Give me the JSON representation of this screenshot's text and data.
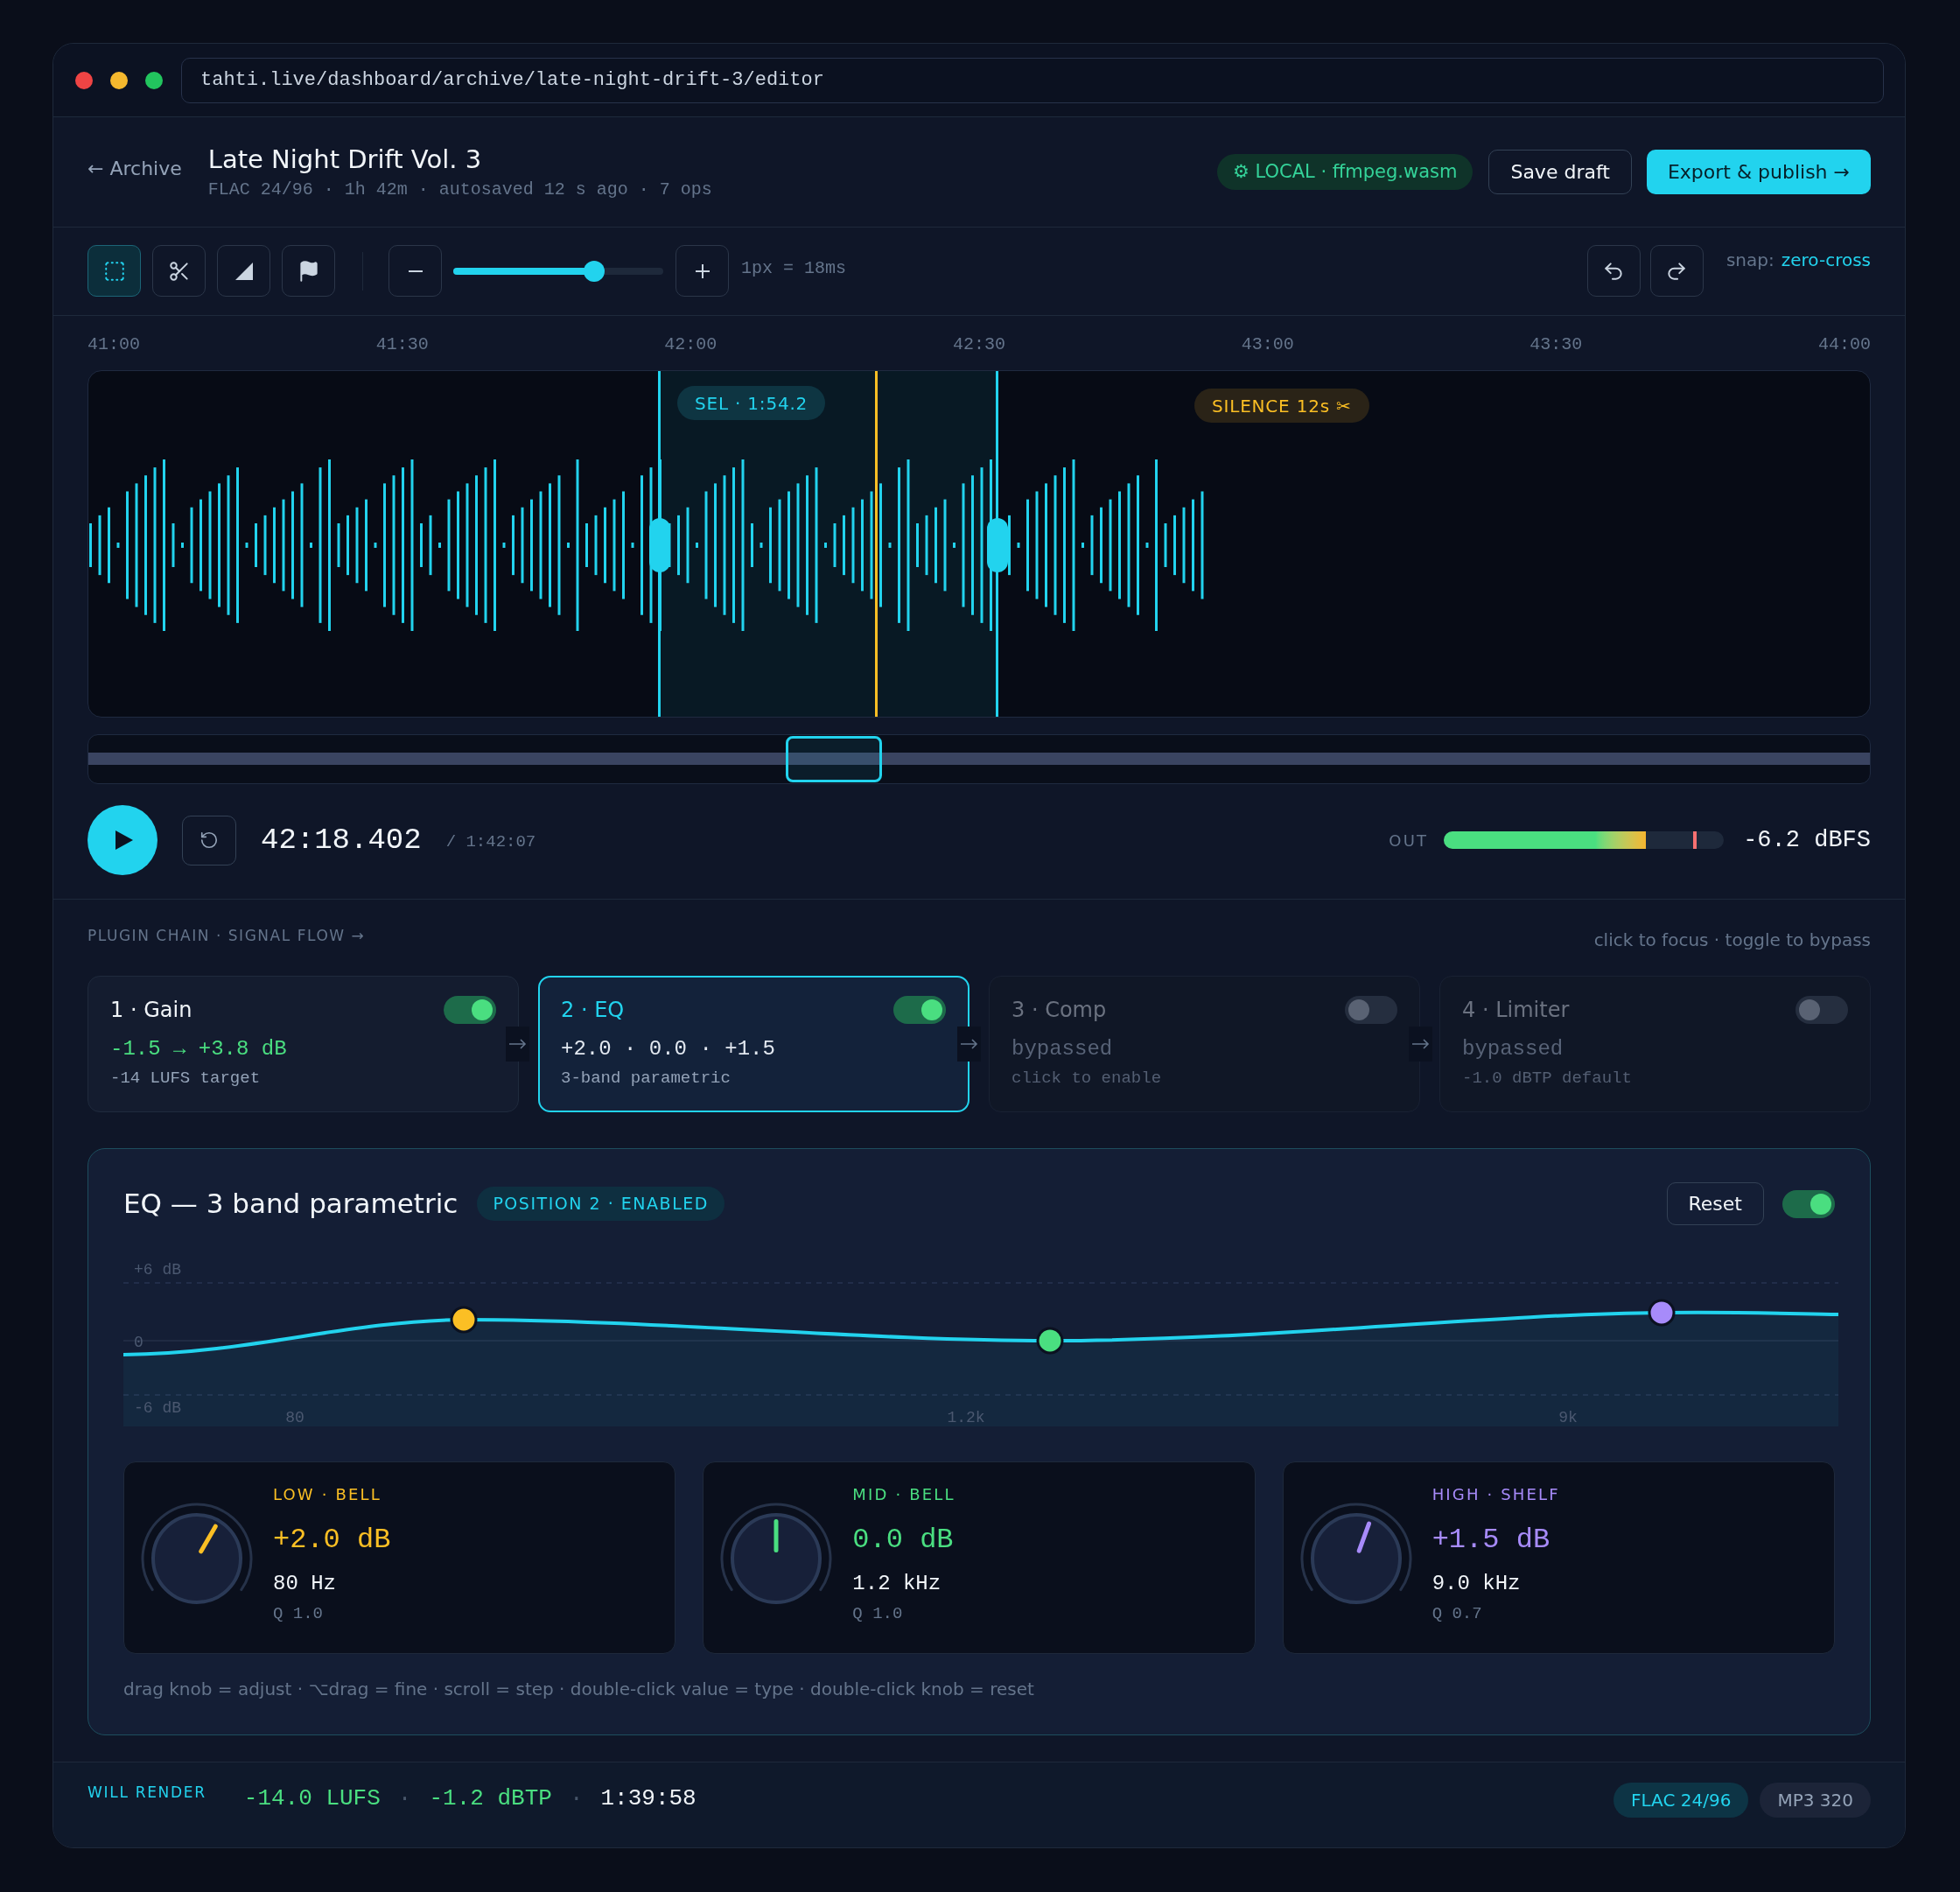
{
  "browser": {
    "url": "tahti.live/dashboard/archive/late-night-drift-3/editor"
  },
  "header": {
    "back_link": "← Archive",
    "title": "Late Night Drift Vol. 3",
    "subtitle": "FLAC 24/96 · 1h 42m · autosaved 12 s ago · 7 ops",
    "engine_badge": "⚙ LOCAL · ffmpeg.wasm",
    "buttons": [
      {
        "label": "Save draft",
        "kind": "secondary"
      },
      {
        "label": "Export & publish →",
        "kind": "primary"
      }
    ]
  },
  "toolbar": {
    "tools": [
      {
        "kind": "select",
        "selected": true
      },
      {
        "kind": "cut",
        "selected": false
      },
      {
        "kind": "fade",
        "selected": false
      },
      {
        "kind": "marker",
        "selected": false
      }
    ],
    "zoom": {
      "level": 0.67
    },
    "scale": "1px = 18ms",
    "snap_label": "snap:",
    "snap_value": "zero-cross"
  },
  "timeline": {
    "ruler": [
      "41:00",
      "41:30",
      "42:00",
      "42:30",
      "43:00",
      "43:30",
      "44:00"
    ],
    "selection_label": "SEL · 1:54.2",
    "silence_label": "SILENCE 12s ✂"
  },
  "transport": {
    "playing": false,
    "time": "42:18.402",
    "duration": "/ 1:42:07",
    "output": {
      "label": "OUT",
      "level": 0.72,
      "peak": {
        "level": 0.89
      },
      "reading": "-6.2 dBFS"
    }
  },
  "plugin_chain": {
    "heading": "PLUGIN CHAIN · SIGNAL FLOW →",
    "hint": "click to focus · toggle to bypass",
    "plugins": [
      {
        "title": "1 · Gain",
        "enabled": true,
        "selected": false,
        "value": "-1.5 → +3.8 dB",
        "note": "-14 LUFS target"
      },
      {
        "title": "2 · EQ",
        "enabled": true,
        "selected": true,
        "value": "+2.0 · 0.0 · +1.5",
        "note": "3-band parametric"
      },
      {
        "title": "3 · Comp",
        "enabled": false,
        "selected": false,
        "value": "bypassed",
        "note": "click to enable"
      },
      {
        "title": "4 · Limiter",
        "enabled": false,
        "selected": false,
        "value": "bypassed",
        "note": "-1.0 dBTP default"
      }
    ]
  },
  "eq_panel": {
    "title": "EQ — 3 band parametric",
    "badge": "POSITION 2 · ENABLED",
    "reset_button": "Reset",
    "enabled": true,
    "graph": {
      "y_labels": [
        "+6 dB",
        "0",
        "-6 dB"
      ],
      "x_labels": [
        "80",
        "1.2k",
        "9k"
      ]
    },
    "bands": [
      {
        "label": "LOW · BELL",
        "color": "#fbbf24",
        "gain": "+2.0 dB",
        "frequency": "80 Hz",
        "q": "Q 1.0",
        "level": 0.62
      },
      {
        "label": "MID · BELL",
        "color": "#4ade80",
        "gain": "0.0 dB",
        "frequency": "1.2 kHz",
        "q": "Q 1.0",
        "level": 0.5
      },
      {
        "label": "HIGH · SHELF",
        "color": "#a78bfa",
        "gain": "+1.5 dB",
        "frequency": "9.0 kHz",
        "q": "Q 0.7",
        "level": 0.58
      }
    ],
    "hint": "drag knob = adjust · ⌥drag = fine · scroll = step · double-click value = type · double-click knob = reset"
  },
  "render_summary": {
    "label": "WILL RENDER",
    "stats": [
      {
        "kind": "value",
        "text": "-14.0 LUFS"
      },
      {
        "kind": "separator",
        "text": "·"
      },
      {
        "kind": "value",
        "text": "-1.2 dBTP"
      },
      {
        "kind": "separator",
        "text": "·"
      },
      {
        "kind": "time",
        "text": "1:39:58"
      }
    ],
    "formats": [
      {
        "label": "FLAC 24/96",
        "selected": true
      },
      {
        "label": "MP3 320",
        "selected": false
      }
    ]
  }
}
